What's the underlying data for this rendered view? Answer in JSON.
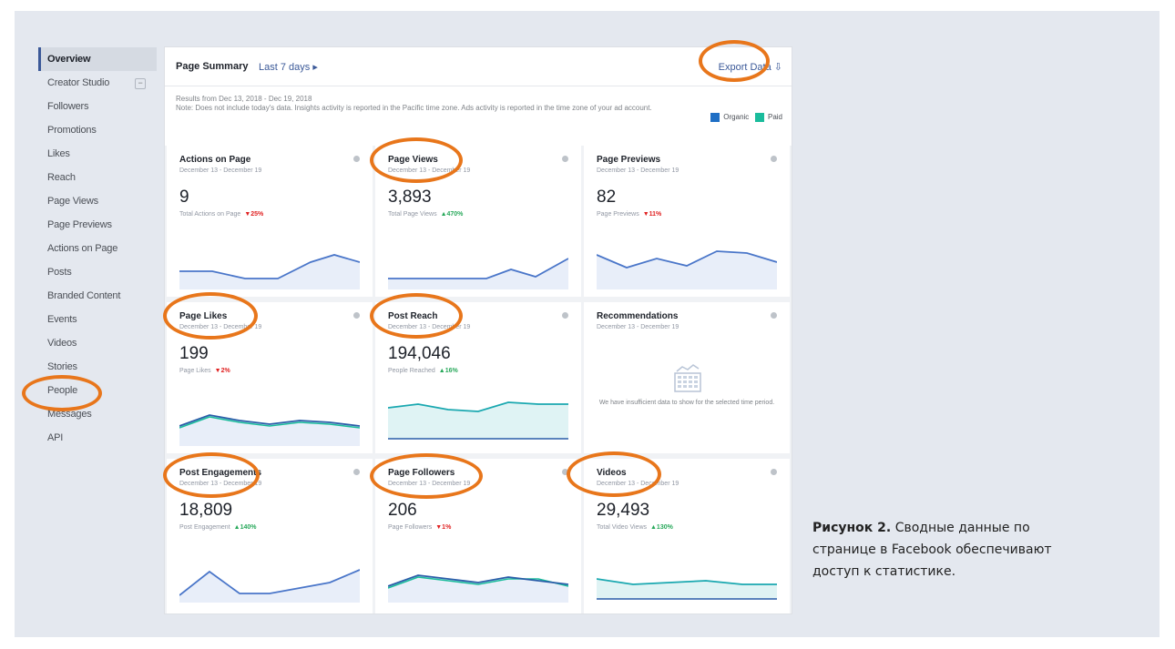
{
  "sidebar": {
    "items": [
      {
        "label": "Overview"
      },
      {
        "label": "Creator Studio"
      },
      {
        "label": "Followers"
      },
      {
        "label": "Promotions"
      },
      {
        "label": "Likes"
      },
      {
        "label": "Reach"
      },
      {
        "label": "Page Views"
      },
      {
        "label": "Page Previews"
      },
      {
        "label": "Actions on Page"
      },
      {
        "label": "Posts"
      },
      {
        "label": "Branded Content"
      },
      {
        "label": "Events"
      },
      {
        "label": "Videos"
      },
      {
        "label": "Stories"
      },
      {
        "label": "People"
      },
      {
        "label": "Messages"
      },
      {
        "label": "API"
      }
    ],
    "toggle": "−"
  },
  "summary": {
    "title": "Page Summary",
    "range": "Last 7 days ▸",
    "export_label": "Export Data",
    "export_icon": "⇩",
    "results_line": "Results from Dec 13, 2018 - Dec 19, 2018",
    "note": "Note: Does not include today's data. Insights activity is reported in the Pacific time zone. Ads activity is reported in the time zone of your ad account.",
    "legend": {
      "organic": "Organic",
      "paid": "Paid",
      "organic_color": "#1f6fc5",
      "paid_color": "#1abc9c"
    }
  },
  "cards": [
    {
      "title": "Actions on Page",
      "sub": "December 13 - December 19",
      "value": "9",
      "metric": "Total Actions on Page",
      "change": "▼25%",
      "dir": "down"
    },
    {
      "title": "Page Views",
      "sub": "December 13 - December 19",
      "value": "3,893",
      "metric": "Total Page Views",
      "change": "▲470%",
      "dir": "up"
    },
    {
      "title": "Page Previews",
      "sub": "December 13 - December 19",
      "value": "82",
      "metric": "Page Previews",
      "change": "▼11%",
      "dir": "down"
    },
    {
      "title": "Page Likes",
      "sub": "December 13 - December 19",
      "value": "199",
      "metric": "Page Likes",
      "change": "▼2%",
      "dir": "down"
    },
    {
      "title": "Post Reach",
      "sub": "December 13 - December 19",
      "value": "194,046",
      "metric": "People Reached",
      "change": "▲16%",
      "dir": "up"
    },
    {
      "title": "Recommendations",
      "sub": "December 13 - December 19",
      "text": "We have insufficient data to show for the selected time period."
    },
    {
      "title": "Post Engagements",
      "sub": "December 13 - December 19",
      "value": "18,809",
      "metric": "Post Engagement",
      "change": "▲140%",
      "dir": "up"
    },
    {
      "title": "Page Followers",
      "sub": "December 13 - December 19",
      "value": "206",
      "metric": "Page Followers",
      "change": "▼1%",
      "dir": "down"
    },
    {
      "title": "Videos",
      "sub": "December 13 - December 19",
      "value": "29,493",
      "metric": "Total Video Views",
      "change": "▲130%",
      "dir": "up"
    }
  ],
  "caption": {
    "bold": "Рисунок 2.",
    "text": "Сводные данные по странице в Facebook обеспечивают доступ к статистике."
  }
}
